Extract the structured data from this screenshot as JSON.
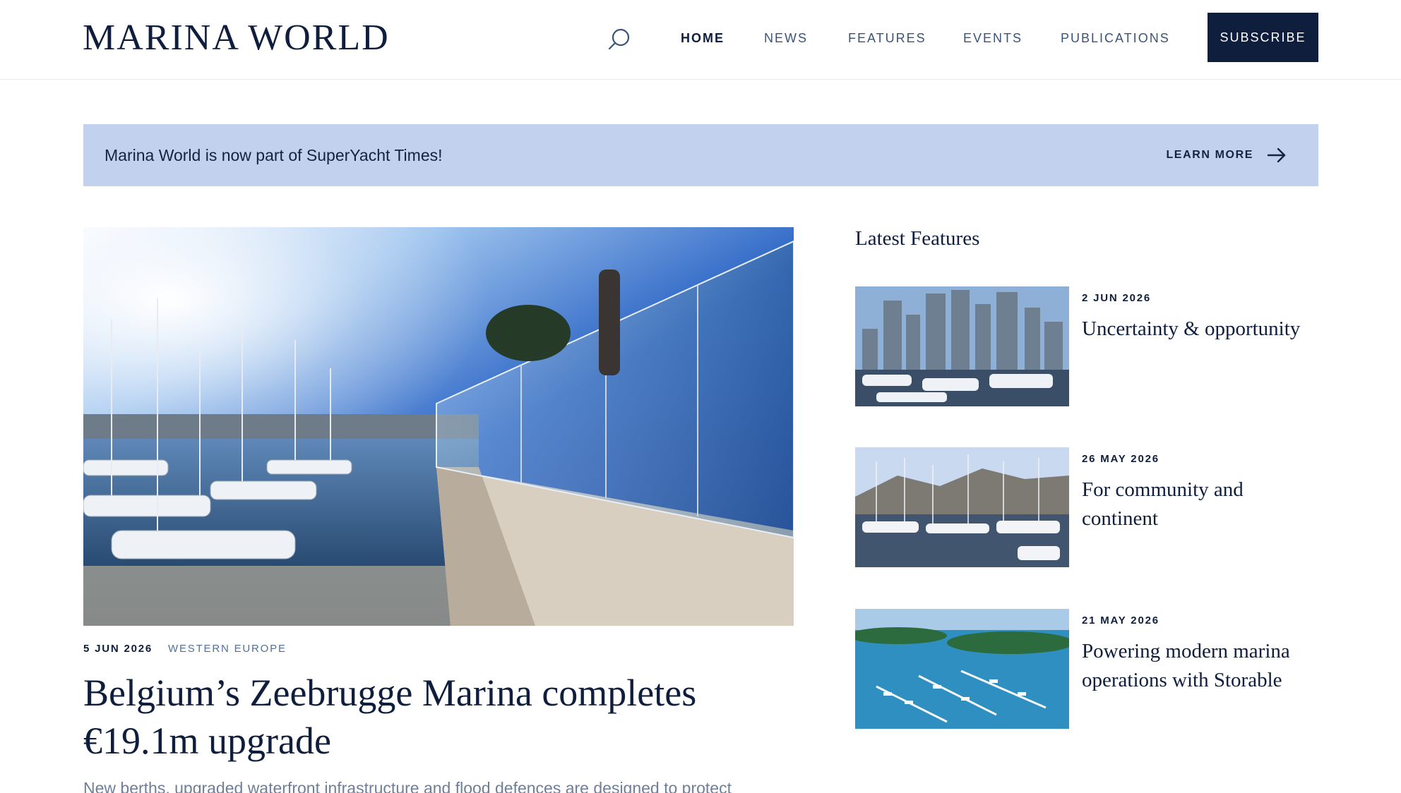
{
  "header": {
    "logo": "MARINA WORLD",
    "nav": [
      {
        "label": "HOME",
        "active": true
      },
      {
        "label": "NEWS"
      },
      {
        "label": "FEATURES"
      },
      {
        "label": "EVENTS"
      },
      {
        "label": "PUBLICATIONS"
      }
    ],
    "subscribe_label": "SUBSCRIBE",
    "search_icon": "search-icon"
  },
  "banner": {
    "text": "Marina World is now part of SuperYacht Times!",
    "link_label": "LEARN MORE",
    "link_icon": "arrow-right-icon",
    "background": "#c2d2ee"
  },
  "main_article": {
    "date": "5 JUN 2026",
    "category": "WESTERN EUROPE",
    "title": "Belgium’s Zeebrugge Marina completes €19.1m upgrade",
    "standfirst": "New berths, upgraded waterfront infrastructure and flood defences are designed to protect"
  },
  "sidebar": {
    "title": "Latest Features",
    "items": [
      {
        "date": "2 JUN 2026",
        "title": "Uncertainty & opportunity"
      },
      {
        "date": "26 MAY 2026",
        "title": "For community and continent"
      },
      {
        "date": "21 MAY 2026",
        "title": "Powering modern marina operations with Storable"
      }
    ]
  },
  "colors": {
    "brand_navy": "#0f1e3d",
    "nav_text": "#3b5475",
    "category_text": "#53709a"
  }
}
